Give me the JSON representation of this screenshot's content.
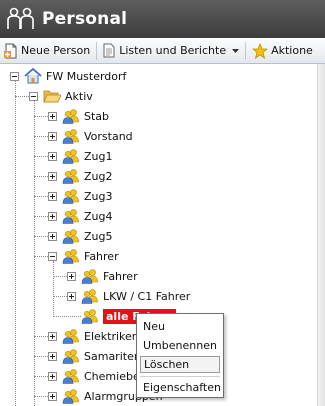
{
  "app": {
    "title": "Personal",
    "title_icon": "people-icon"
  },
  "toolbar": {
    "new_person_label": "Neue Person",
    "lists_reports_label": "Listen und Berichte",
    "actions_label": "Aktione"
  },
  "tree": {
    "root_label": "FW Musterdorf",
    "active_label": "Aktiv",
    "groups": [
      "Stab",
      "Vorstand",
      "Zug1",
      "Zug2",
      "Zug3",
      "Zug4",
      "Zug5"
    ],
    "fahrer_label": "Fahrer",
    "fahrer_children": [
      "Fahrer",
      "LKW / C1 Fahrer",
      "alle Fahrer"
    ],
    "more_groups": [
      "Elektriker",
      "Samariter",
      "Chemiebe",
      "Alarmgruppen"
    ]
  },
  "context_menu": {
    "items": [
      "Neu",
      "Umbenennen",
      "Löschen",
      "Eigenschaften"
    ],
    "hovered": "Löschen"
  },
  "colors": {
    "titlebar": "#4a4a4a",
    "selection": "#e5101c",
    "group_icon_yellow": "#f0c020",
    "group_icon_blue": "#4a7fd0"
  }
}
